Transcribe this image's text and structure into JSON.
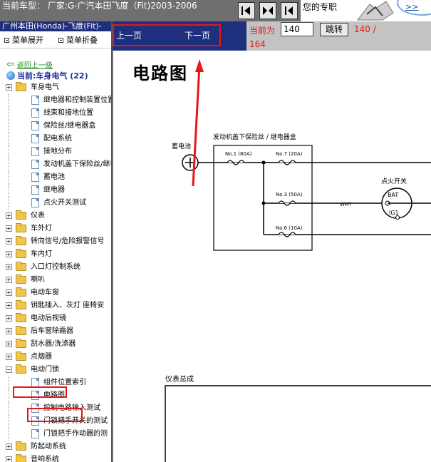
{
  "header": {
    "car_model": "当前车型： 厂家:G-广汽本田飞度（Fit)2003-2006",
    "ad_text": "您的专职",
    "ad_link": ">>"
  },
  "sidebar": {
    "title": "广州本田(Honda)-飞度(Fit)-",
    "expand_all": "菜单展开",
    "collapse_all": "菜单折叠",
    "back_link": "返回上一级",
    "current": "当前:车身电气 (22)",
    "tree": [
      {
        "label": "车身电气",
        "type": "folder"
      },
      {
        "label": "继电器和控制装置位置",
        "type": "doc"
      },
      {
        "label": "线束和接地位置",
        "type": "doc"
      },
      {
        "label": "保险丝/继电器盒",
        "type": "doc"
      },
      {
        "label": "配电系统",
        "type": "doc"
      },
      {
        "label": "接地分布",
        "type": "doc"
      },
      {
        "label": "发动机盖下保险丝/继电",
        "type": "doc"
      },
      {
        "label": "蓄电池",
        "type": "doc"
      },
      {
        "label": "继电器",
        "type": "doc"
      },
      {
        "label": "点火开关测试",
        "type": "doc"
      },
      {
        "label": "仪表",
        "type": "folder"
      },
      {
        "label": "车外灯",
        "type": "folder"
      },
      {
        "label": "转向信号/危险报警信号",
        "type": "folder"
      },
      {
        "label": "车内灯",
        "type": "folder"
      },
      {
        "label": "入口灯控制系统",
        "type": "folder"
      },
      {
        "label": "喇叭",
        "type": "folder"
      },
      {
        "label": "电动车窗",
        "type": "folder"
      },
      {
        "label": "钥匙插入、灰灯 座椅安",
        "type": "folder"
      },
      {
        "label": "电动后视镜",
        "type": "folder"
      },
      {
        "label": "后车窗除霜器",
        "type": "folder"
      },
      {
        "label": "刮水器/洗涤器",
        "type": "folder"
      },
      {
        "label": "点烟器",
        "type": "folder"
      },
      {
        "label": "电动门锁",
        "type": "folder-open"
      },
      {
        "label": "组件位置索引",
        "type": "doc"
      },
      {
        "label": "电路图",
        "type": "doc"
      },
      {
        "label": "控制电路输入测试",
        "type": "doc"
      },
      {
        "label": "门锁把手开关的测试",
        "type": "doc"
      },
      {
        "label": "门锁把手作动器的测",
        "type": "doc"
      },
      {
        "label": "防起动系统",
        "type": "folder"
      },
      {
        "label": "音响系统",
        "type": "folder"
      }
    ]
  },
  "pager": {
    "prev": "上一页",
    "next": "下一页",
    "current_label": "当前为",
    "page_value": "140",
    "go": "跳转",
    "total_a": "140 /",
    "total_b": "164"
  },
  "document": {
    "title": "电路图",
    "battery": "蓄电池",
    "fuse_box": "发动机盖下保险丝 / 继电器盒",
    "ignition": "点火开关",
    "fuse_1": "No.1 (80A)",
    "fuse_7": "No.7 (20A)",
    "fuse_3": "No.3 (50A)",
    "fuse_6": "No.6 (10A)",
    "wire": "WHT",
    "bat": "BAT",
    "ig1": "IG1",
    "panel_title": "仪表总成"
  },
  "colors": {
    "navy": "#1e2f7d",
    "highlight": "#e8151b",
    "folder": "#f0c64a"
  }
}
